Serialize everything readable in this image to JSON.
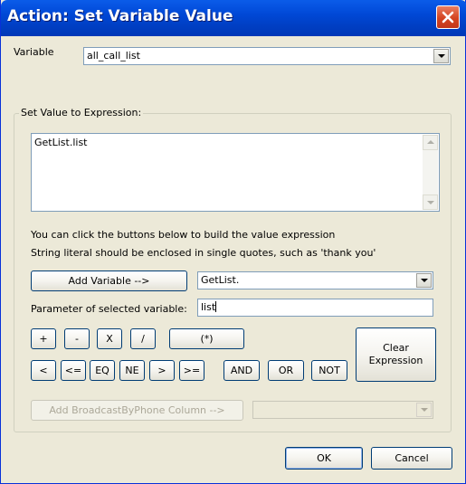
{
  "window": {
    "title": "Action: Set Variable Value"
  },
  "variable": {
    "label": "Variable",
    "selected": "all_call_list"
  },
  "expression_group": {
    "legend": "Set Value to Expression:",
    "expression_text": "GetList.list",
    "hint_line1": "You can click the buttons below to build the value expression",
    "hint_line2": "String literal should be enclosed in single quotes, such as 'thank you'"
  },
  "add_variable": {
    "button_label": "Add Variable -->",
    "selected": "GetList."
  },
  "parameter": {
    "label": "Parameter of selected variable:",
    "value": "list"
  },
  "operators": {
    "plus": "+",
    "minus": "-",
    "multiply": "X",
    "divide": "/",
    "parens": "(*)",
    "lt": "<",
    "le": "<=",
    "eq": "EQ",
    "ne": "NE",
    "gt": ">",
    "ge": ">=",
    "and": "AND",
    "or": "OR",
    "not": "NOT"
  },
  "clear_expression": {
    "label": "Clear Expression"
  },
  "broadcast": {
    "button_label": "Add BroadcastByPhone Column -->",
    "selected": ""
  },
  "footer": {
    "ok_label": "OK",
    "cancel_label": "Cancel"
  },
  "colors": {
    "titlebar": "#0048d6",
    "close": "#d44421",
    "dialog_bg": "#ece9d8"
  }
}
